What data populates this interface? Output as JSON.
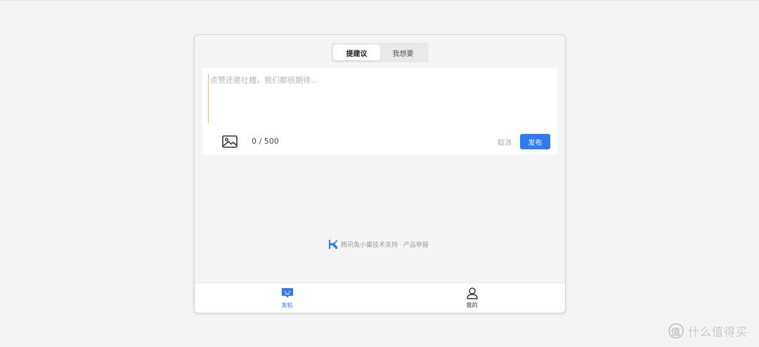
{
  "tabs": {
    "active": "提建议",
    "other": "我想要"
  },
  "composer": {
    "placeholder": "点赞还是吐槽，我们都很期待...",
    "counter": "0 / 500",
    "cancel_label": "取消",
    "publish_label": "发布"
  },
  "footer": {
    "support_text": "腾讯兔小巢技术支持 ·",
    "report_label": "产品举报"
  },
  "bottom_nav": {
    "post_label": "发帖",
    "mine_label": "我的"
  },
  "watermark": {
    "logo": "值",
    "text": "什么值得买"
  },
  "colors": {
    "accent": "#2f7af6",
    "background": "#f4f4f4",
    "panel": "#f5f5f5"
  }
}
